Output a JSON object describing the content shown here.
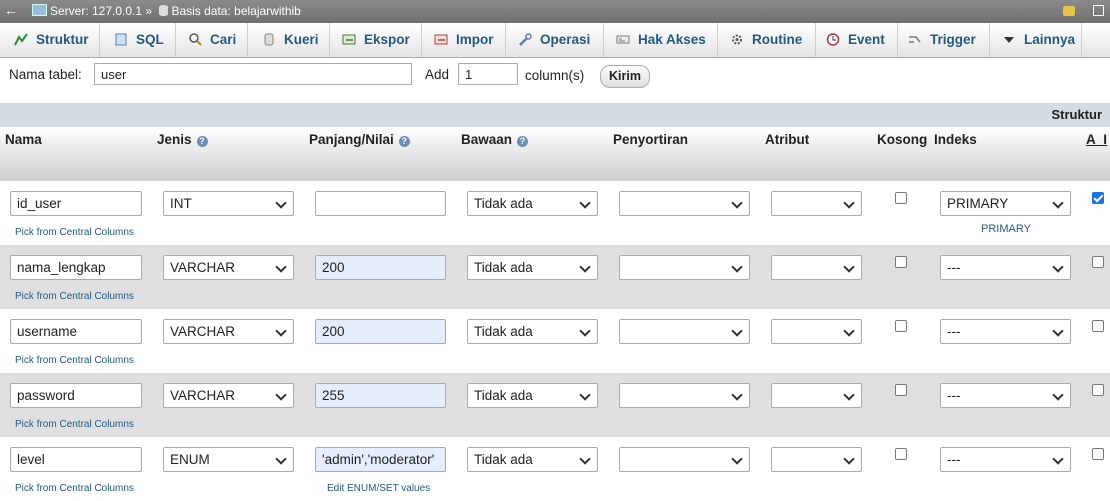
{
  "breadcrumb": {
    "back_glyph": "←",
    "server_label": "Server: 127.0.0.1",
    "separator": "»",
    "database_label": "Basis data: belajarwithib"
  },
  "tabs": [
    {
      "label": "Struktur"
    },
    {
      "label": "SQL"
    },
    {
      "label": "Cari"
    },
    {
      "label": "Kueri"
    },
    {
      "label": "Ekspor"
    },
    {
      "label": "Impor"
    },
    {
      "label": "Operasi"
    },
    {
      "label": "Hak Akses"
    },
    {
      "label": "Routine"
    },
    {
      "label": "Event"
    },
    {
      "label": "Trigger"
    },
    {
      "label": "Lainnya"
    }
  ],
  "form": {
    "table_name_label": "Nama tabel:",
    "table_name_value": "user",
    "add_label": "Add",
    "add_value": "1",
    "columns_label": "column(s)",
    "submit_label": "Kirim"
  },
  "structure_header": "Struktur",
  "columns_header": {
    "nama": "Nama",
    "jenis": "Jenis",
    "panjang": "Panjang/Nilai",
    "bawaan": "Bawaan",
    "penyortiran": "Penyortiran",
    "atribut": "Atribut",
    "kosong": "Kosong",
    "indeks": "Indeks",
    "ai": "A_I"
  },
  "fields": [
    {
      "name": "id_user",
      "type": "INT",
      "length": "",
      "default": "Tidak ada",
      "collation": "",
      "attribute": "",
      "null": false,
      "index": "PRIMARY",
      "index_note": "PRIMARY",
      "ai": true,
      "central_link": "Pick from Central Columns",
      "length_note": ""
    },
    {
      "name": "nama_lengkap",
      "type": "VARCHAR",
      "length": "200",
      "default": "Tidak ada",
      "collation": "",
      "attribute": "",
      "null": false,
      "index": "---",
      "index_note": "",
      "ai": false,
      "central_link": "Pick from Central Columns",
      "length_note": ""
    },
    {
      "name": "username",
      "type": "VARCHAR",
      "length": "200",
      "default": "Tidak ada",
      "collation": "",
      "attribute": "",
      "null": false,
      "index": "---",
      "index_note": "",
      "ai": false,
      "central_link": "Pick from Central Columns",
      "length_note": ""
    },
    {
      "name": "password",
      "type": "VARCHAR",
      "length": "255",
      "default": "Tidak ada",
      "collation": "",
      "attribute": "",
      "null": false,
      "index": "---",
      "index_note": "",
      "ai": false,
      "central_link": "Pick from Central Columns",
      "length_note": ""
    },
    {
      "name": "level",
      "type": "ENUM",
      "length": "'admin','moderator'",
      "default": "Tidak ada",
      "collation": "",
      "attribute": "",
      "null": false,
      "index": "---",
      "index_note": "",
      "ai": false,
      "central_link": "Pick from Central Columns",
      "length_note": "Edit ENUM/SET values"
    }
  ]
}
